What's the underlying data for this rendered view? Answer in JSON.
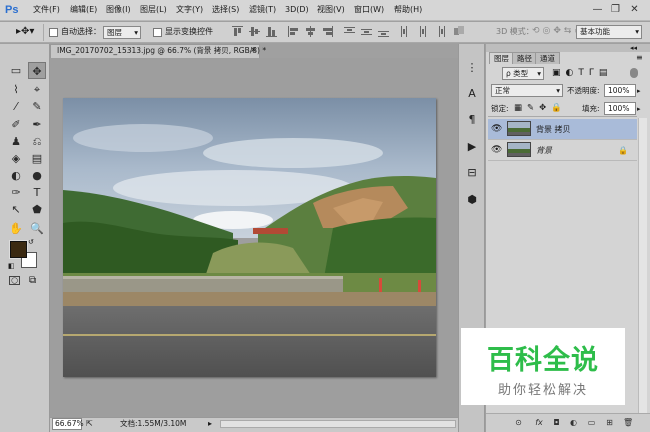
{
  "app": {
    "logo": "Ps"
  },
  "menu": [
    "文件(F)",
    "编辑(E)",
    "图像(I)",
    "图层(L)",
    "文字(Y)",
    "选择(S)",
    "滤镜(T)",
    "3D(D)",
    "视图(V)",
    "窗口(W)",
    "帮助(H)"
  ],
  "window_controls": [
    "—",
    "❐",
    "✕"
  ],
  "options_bar": {
    "auto_select_label": "自动选择：",
    "auto_select_value": "图层",
    "show_transform_label": "显示变换控件",
    "mode_3d_label": "3D 模式：",
    "workspace_value": "基本功能"
  },
  "document": {
    "tab_title": "IMG_20170702_15313.jpg @ 66.7% (背景 拷贝, RGB/8) *",
    "close": "×",
    "zoom": "66.67%",
    "doc_info": "文档:1.55M/3.10M",
    "nav_arrow": "▸"
  },
  "colors": {
    "foreground": "#3b2a12",
    "background": "#ffffff",
    "accent_selection": "#a9bbd9",
    "watermark_green": "#2ebd4a"
  },
  "panel": {
    "tabs": [
      "图层",
      "路径",
      "通道"
    ],
    "filter_label": "ρ 类型",
    "blend_mode": "正常",
    "opacity_label": "不透明度:",
    "opacity_value": "100%",
    "lock_label": "锁定:",
    "fill_label": "填充:",
    "fill_value": "100%",
    "layers": [
      {
        "name": "背景 拷贝",
        "visible_icon": "eye-icon",
        "selected": true
      },
      {
        "name": "背景",
        "visible_icon": "eye-icon",
        "locked": true,
        "selected": false
      }
    ],
    "bottom_icons": [
      "link-icon",
      "fx-icon",
      "mask-icon",
      "adjustment-icon",
      "group-icon",
      "new-layer-icon",
      "trash-icon"
    ],
    "bottom_icon_glyphs": [
      "⊙",
      "fx",
      "◘",
      "◐",
      "▭",
      "⊞",
      "🗑"
    ]
  },
  "strip_icons": [
    "swatch-history-icon",
    "character-icon",
    "paragraph-icon",
    "actions-play-icon",
    "properties-icon",
    "3d-cube-icon"
  ],
  "strip_glyphs": [
    "⋮",
    "A",
    "¶",
    "▶",
    "⊟",
    "⬢"
  ],
  "tools": [
    [
      "▭",
      "✥"
    ],
    [
      "⌇",
      "⌖"
    ],
    [
      "⁄",
      "✎"
    ],
    [
      "✐",
      "✒"
    ],
    [
      "♟",
      "⎌"
    ],
    [
      "◈",
      "▤"
    ],
    [
      "◐",
      "●"
    ],
    [
      "✑",
      "T"
    ],
    [
      "↖",
      "⬟"
    ],
    [
      "✋",
      "🔍"
    ]
  ],
  "watermark": {
    "title": "百科全说",
    "subtitle": "助你轻松解决"
  }
}
